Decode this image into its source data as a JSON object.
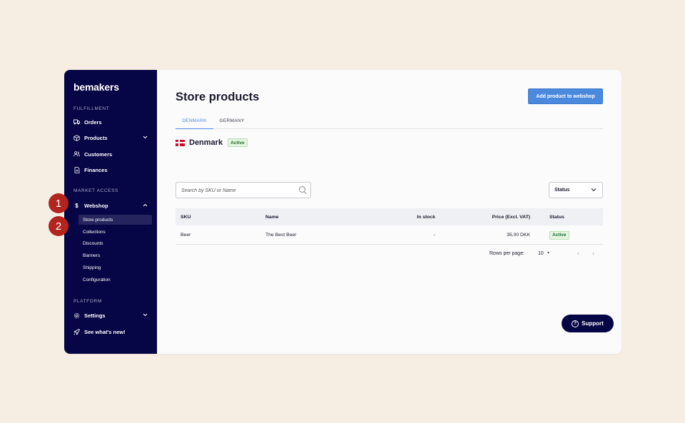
{
  "sidebar": {
    "logo": "bemakers",
    "sections": {
      "fulfillment": "FULFILLMENT",
      "market_access": "MARKET ACCESS",
      "platform": "PLATFORM"
    },
    "items": {
      "orders": "Orders",
      "products": "Products",
      "customers": "Customers",
      "finances": "Finances",
      "webshop": "Webshop",
      "settings": "Settings",
      "whats_new": "See what's new!"
    },
    "webshop_sub": {
      "store_products": "Store products",
      "collections": "Collections",
      "discounts": "Discounts",
      "banners": "Banners",
      "shipping": "Shipping",
      "configuration": "Configuration"
    }
  },
  "main": {
    "title": "Store products",
    "add_button": "Add product to webshop",
    "tabs": [
      "DENMARK",
      "GERMANY"
    ],
    "country": {
      "name": "Denmark",
      "badge": "Active"
    },
    "search": {
      "placeholder": "Search by SKU or Name"
    },
    "status_filter": "Status",
    "table": {
      "headers": {
        "sku": "SKU",
        "name": "Name",
        "in_stock": "In stock",
        "price": "Price (Excl. VAT)",
        "status": "Status"
      },
      "rows": [
        {
          "sku": "Beer",
          "name": "The Best Beer",
          "in_stock": "-",
          "price": "35,00 DKK",
          "status": "Active"
        }
      ]
    },
    "pagination": {
      "rows_per_page_label": "Rows per page:",
      "rows_per_page": "10"
    }
  },
  "support_label": "Support",
  "steps": [
    "1",
    "2"
  ],
  "colors": {
    "sidebar_bg": "#060545",
    "accent": "#4b89df",
    "step_marker": "#b3241f",
    "background": "#f6eee2"
  }
}
